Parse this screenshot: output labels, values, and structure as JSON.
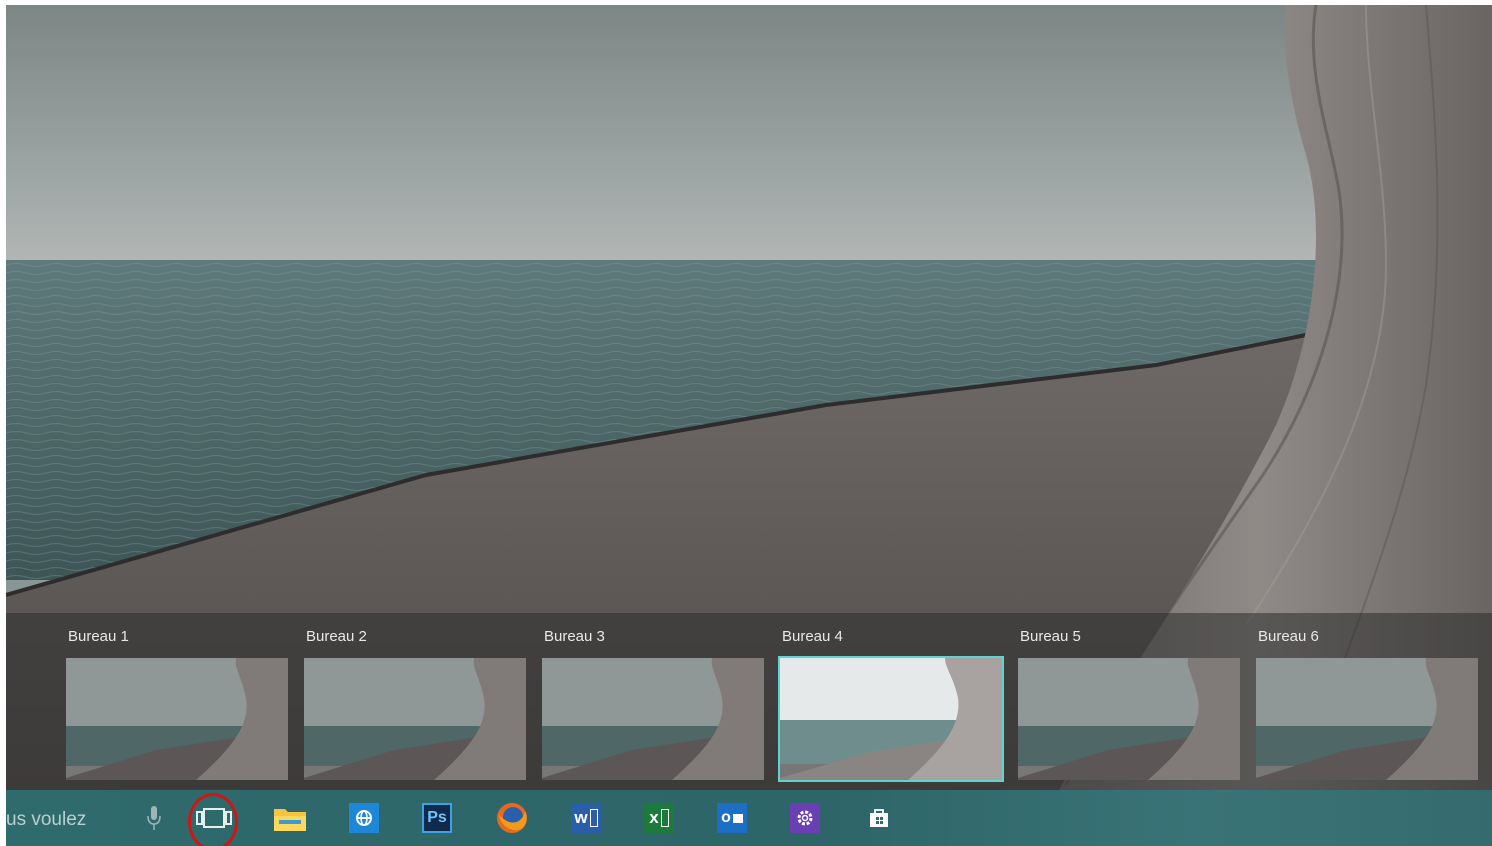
{
  "taskbar": {
    "search_text": "us voulez",
    "icons": [
      "microphone-icon",
      "task-view-icon",
      "file-explorer-icon",
      "internet-explorer-icon",
      "photoshop-icon",
      "firefox-icon",
      "word-icon",
      "excel-icon",
      "outlook-icon",
      "settings-icon",
      "store-icon"
    ],
    "photoshop_label": "Ps",
    "word_label": "w",
    "excel_label": "x",
    "outlook_label": "o"
  },
  "virtual_desktops": {
    "items": [
      {
        "label": "Bureau 1",
        "active": false
      },
      {
        "label": "Bureau 2",
        "active": false
      },
      {
        "label": "Bureau 3",
        "active": false
      },
      {
        "label": "Bureau 4",
        "active": true
      },
      {
        "label": "Bureau 5",
        "active": false
      },
      {
        "label": "Bureau 6",
        "active": false
      }
    ]
  },
  "colors": {
    "taskbar": "#2f6a6d",
    "active_border": "#5fd3cf",
    "highlight_circle": "#d11515"
  }
}
